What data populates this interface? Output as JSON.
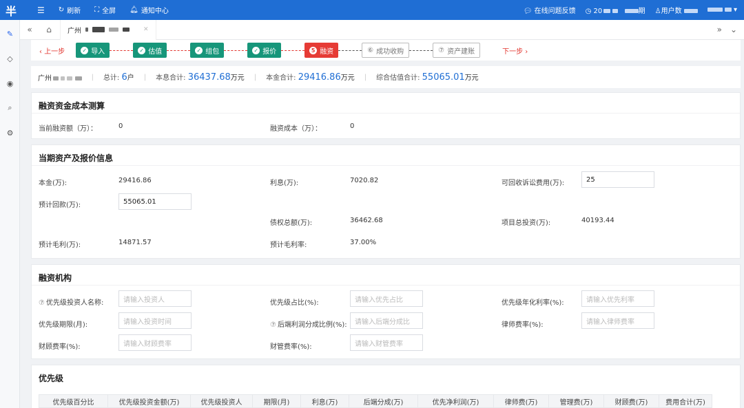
{
  "topbar": {
    "logo": "半",
    "menu_icon": "menu-icon",
    "refresh": "刷新",
    "fullscreen": "全屏",
    "notify": "通知中心",
    "feedback": "在线问题反馈",
    "date_prefix": "20",
    "period_suffix": "期",
    "user_count": "用户数"
  },
  "tabs": {
    "active_tab": "广州",
    "nav_back": "«",
    "nav_forward": "»"
  },
  "steps": {
    "prev": "上一步",
    "next": "下一步",
    "items": [
      {
        "label": "导入",
        "state": "done"
      },
      {
        "label": "估值",
        "state": "done"
      },
      {
        "label": "组包",
        "state": "done"
      },
      {
        "label": "报价",
        "state": "done"
      },
      {
        "label": "融资",
        "state": "active",
        "num": "5"
      },
      {
        "label": "成功收购",
        "state": "todo",
        "num": "6"
      },
      {
        "label": "资产建账",
        "state": "todo",
        "num": "7"
      }
    ]
  },
  "summary": {
    "name": "广州",
    "count_label": "总计:",
    "count_value": "6",
    "count_unit": "户",
    "interest_label": "本息合计:",
    "interest_value": "36437.68",
    "principal_label": "本金合计:",
    "principal_value": "29416.86",
    "valuation_label": "综合估值合计:",
    "valuation_value": "55065.01",
    "unit": "万元"
  },
  "financing_cost": {
    "title": "融资资金成本测算",
    "amount_label": "当前融资额（万）：",
    "amount_value": "0",
    "cost_label": "融资成本（万）：",
    "cost_value": "0"
  },
  "current_assets": {
    "title": "当期资产及报价信息",
    "principal_label": "本金(万):",
    "principal_value": "29416.86",
    "interest_label": "利息(万):",
    "interest_value": "7020.82",
    "litigation_label": "可回收诉讼费用(万):",
    "litigation_value": "25",
    "expected_recovery_label": "预计回款(万):",
    "expected_recovery_value": "55065.01",
    "total_claims_label": "债权总额(万):",
    "total_claims_value": "36462.68",
    "total_investment_label": "项目总投资(万):",
    "total_investment_value": "40193.44",
    "gross_profit_label": "预计毛利(万):",
    "gross_profit_value": "14871.57",
    "gross_margin_label": "预计毛利率:",
    "gross_margin_value": "37.00%"
  },
  "institution": {
    "title": "融资机构",
    "help": "⑦",
    "investor_label": "优先级投资人名称:",
    "investor_ph": "请输入投资人",
    "ratio_label": "优先级占比(%):",
    "ratio_ph": "请输入优先占比",
    "rate_label": "优先级年化利率(%):",
    "rate_ph": "请输入优先利率",
    "term_label": "优先级期限(月):",
    "term_ph": "请输入投资时间",
    "profit_share_label": "后端利润分成比例(%):",
    "profit_share_ph": "请输入后端分成比",
    "lawyer_label": "律师费率(%):",
    "lawyer_ph": "请输入律师费率",
    "finance_label": "财顾费率(%):",
    "finance_ph": "请输入财顾费率",
    "mgmt_label": "财管费率(%):",
    "mgmt_ph": "请输入财管费率"
  },
  "priority": {
    "title": "优先级",
    "columns": [
      "优先级百分比",
      "优先级投资金额(万)",
      "优先级投资人",
      "期限(月)",
      "利息(万)",
      "后端分成(万)",
      "优先净利润(万)",
      "律师费(万)",
      "管理费(万)",
      "财顾费(万)",
      "费用合计(万)"
    ]
  }
}
